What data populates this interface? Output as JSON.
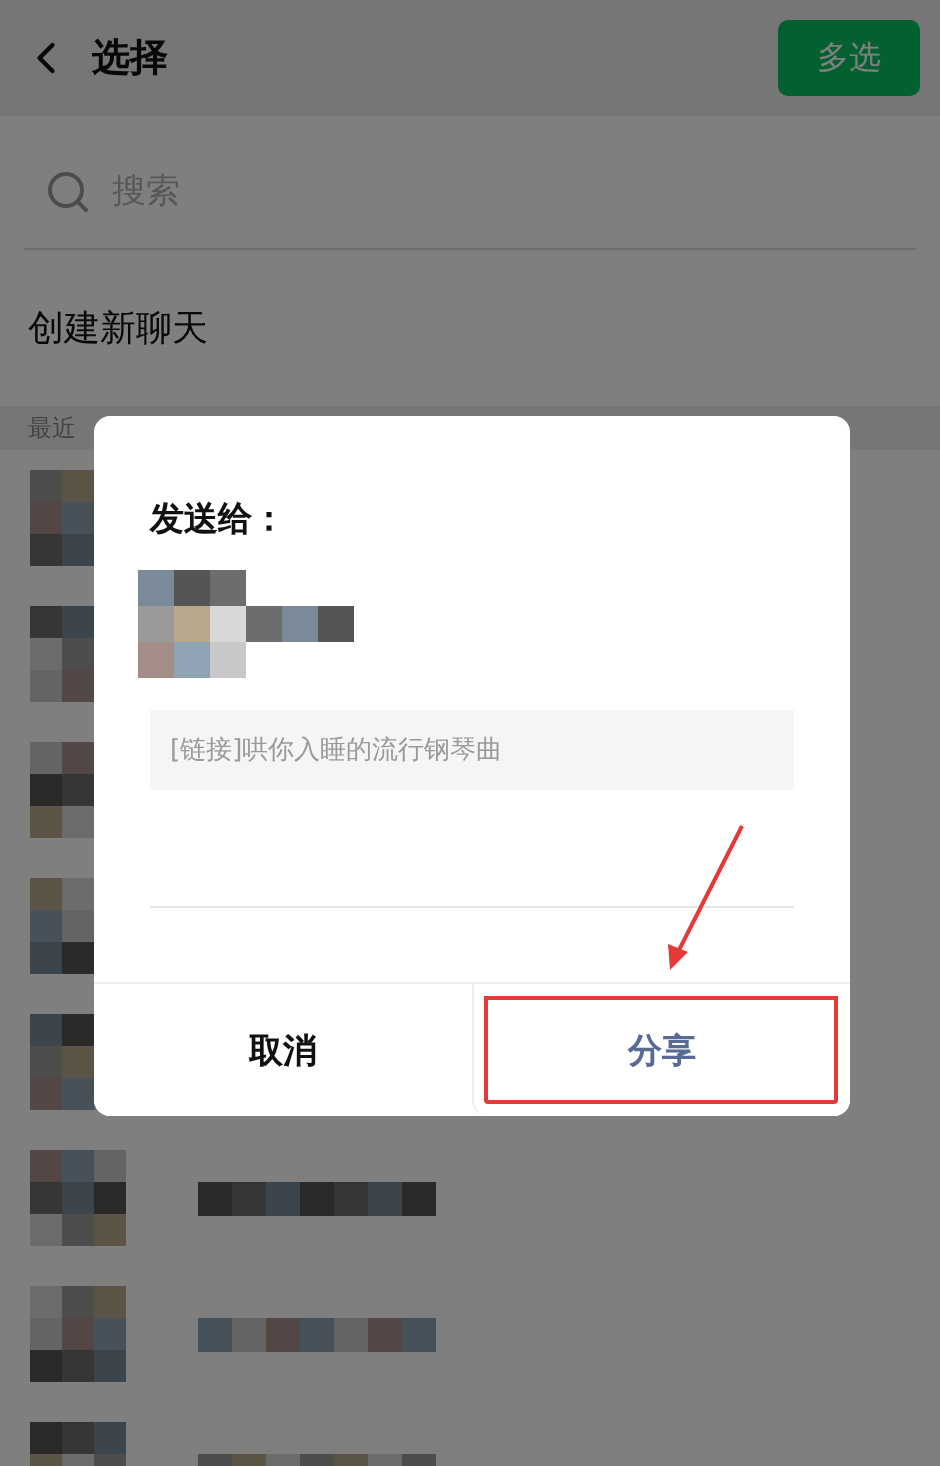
{
  "header": {
    "title": "选择",
    "action": "多选"
  },
  "search": {
    "placeholder": "搜索"
  },
  "new_chat": "创建新聊天",
  "section_label": "最近",
  "chats": [
    {
      "kind": "avatar_only"
    },
    {
      "kind": "avatar_only"
    },
    {
      "kind": "avatar_only"
    },
    {
      "kind": "avatar_only"
    },
    {
      "kind": "blurred"
    },
    {
      "kind": "blurred"
    },
    {
      "kind": "blurred"
    },
    {
      "kind": "blurred"
    }
  ],
  "dialog": {
    "title": "发送给：",
    "recipient": {
      "kind": "blurred"
    },
    "message": "[链接]哄你入睡的流行钢琴曲",
    "buttons": [
      {
        "label": "取消",
        "kind": "cancel",
        "highlighted": false
      },
      {
        "label": "分享",
        "kind": "confirm",
        "highlighted": true
      }
    ]
  }
}
